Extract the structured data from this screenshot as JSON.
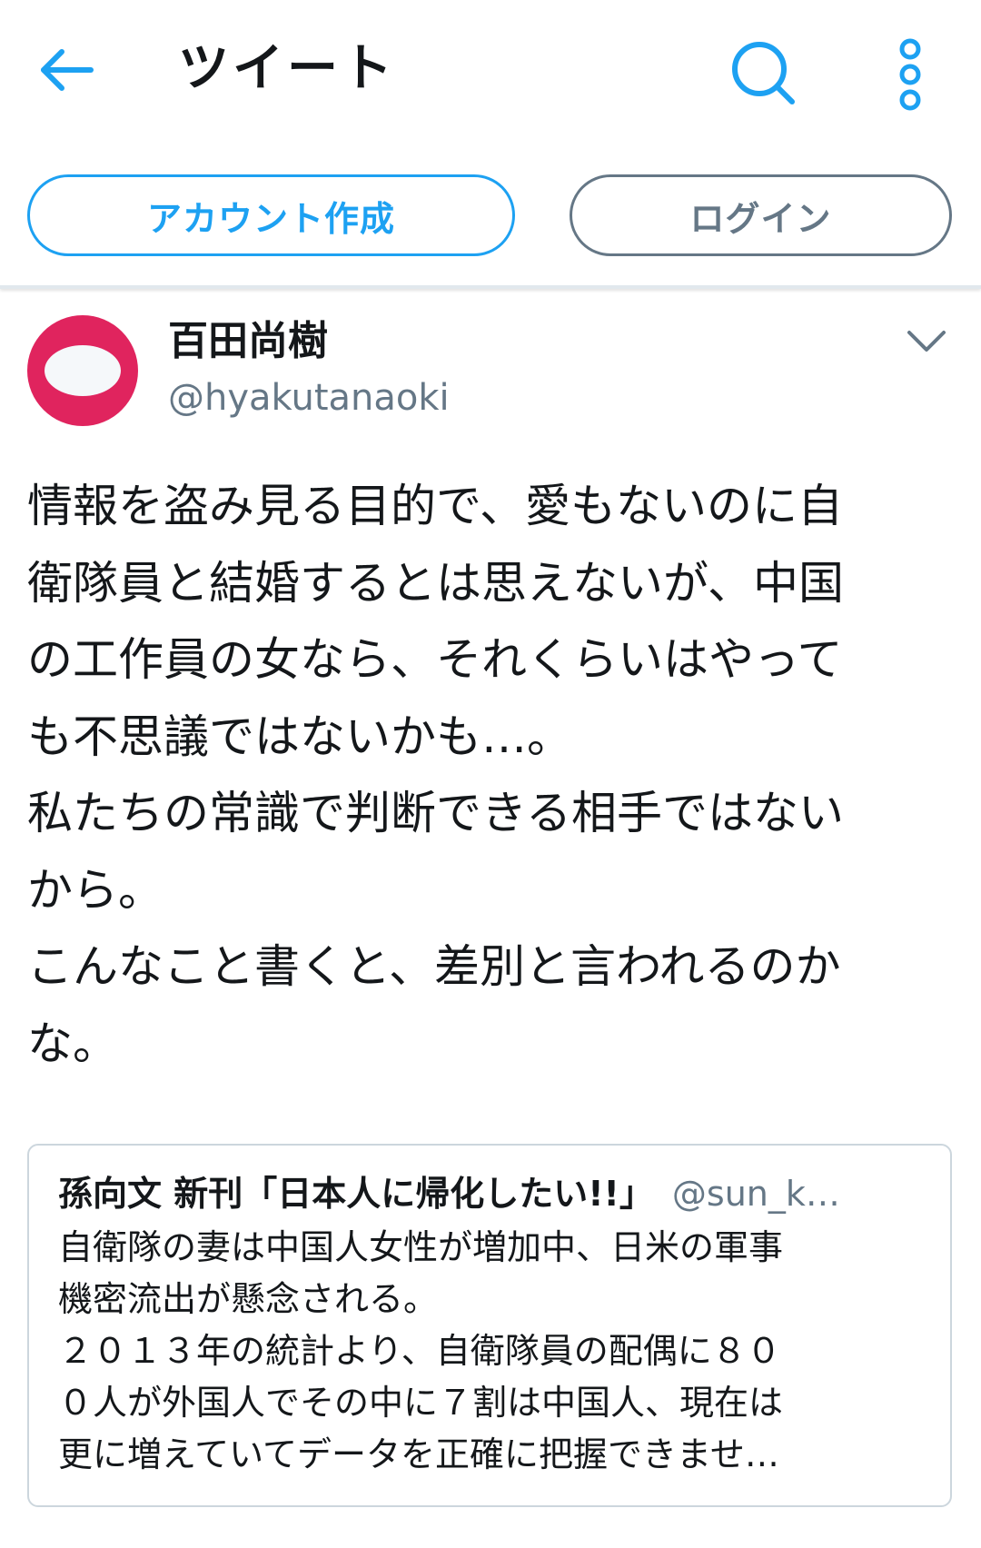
{
  "header": {
    "title": "ツイート",
    "back_icon": "arrow-left-icon",
    "search_icon": "search-icon",
    "more_icon": "more-vertical-icon",
    "accent_color": "#1da1f2"
  },
  "auth": {
    "signup_label": "アカウント作成",
    "login_label": "ログイン"
  },
  "tweet": {
    "display_name": "百田尚樹",
    "handle": "@hyakutanaoki",
    "avatar_colors": {
      "bg": "#e0245e",
      "inner": "#f5f8fa"
    },
    "text_lines": [
      "情報を盗み見る目的で、愛もないのに自",
      "衛隊員と結婚するとは思えないが、中国",
      "の工作員の女なら、それくらいはやって",
      "も不思議ではないかも…。",
      "私たちの常識で判断できる相手ではない",
      "から。",
      "こんなこと書くと、差別と言われるのか",
      "な。"
    ]
  },
  "quoted_tweet": {
    "display_name": "孫向文 新刊「日本人に帰化したい!!」",
    "handle": "@sun_k…",
    "text_lines": [
      "自衛隊の妻は中国人女性が増加中、日米の軍事",
      "機密流出が懸念される。",
      "２０１３年の統計より、自衛隊員の配偶に８０",
      "０人が外国人でその中に７割は中国人、現在は",
      "更に増えていてデータを正確に把握できませ…"
    ]
  }
}
